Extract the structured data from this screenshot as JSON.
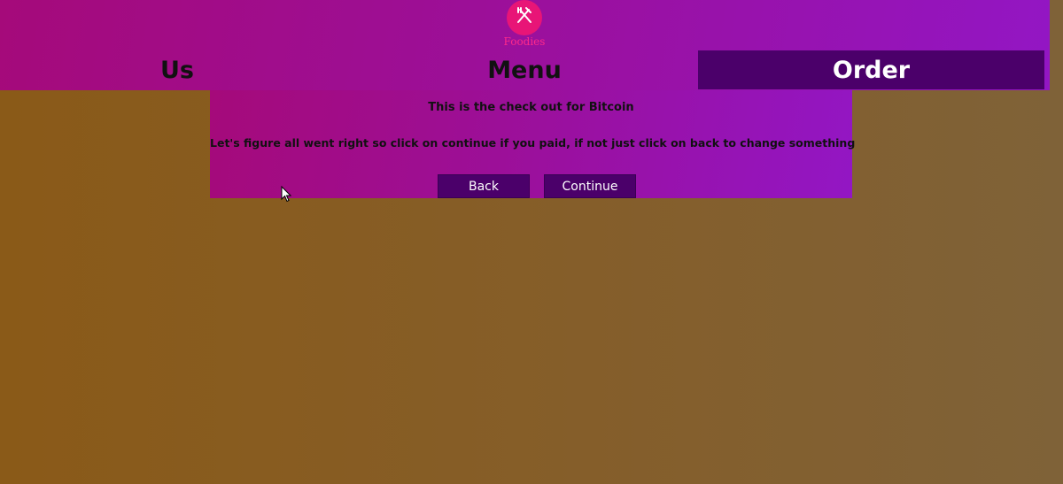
{
  "brand": {
    "name": "Foodies",
    "icon": "fork-knife-icon",
    "icon_color": "#e81577"
  },
  "nav": {
    "us_label": "Us",
    "menu_label": "Menu",
    "order_label": "Order",
    "active": "Order",
    "active_color": "#4b006a"
  },
  "checkout": {
    "title": "This is the check out for Bitcoin",
    "message": "Let's figure all went right so click on continue if you paid, if not just click on back to change something",
    "back_label": "Back",
    "continue_label": "Continue"
  },
  "colors": {
    "header_gradient_start": "#a50a7a",
    "header_gradient_end": "#9316c4",
    "background_start": "#8a5a18",
    "background_end": "#7f6238"
  }
}
